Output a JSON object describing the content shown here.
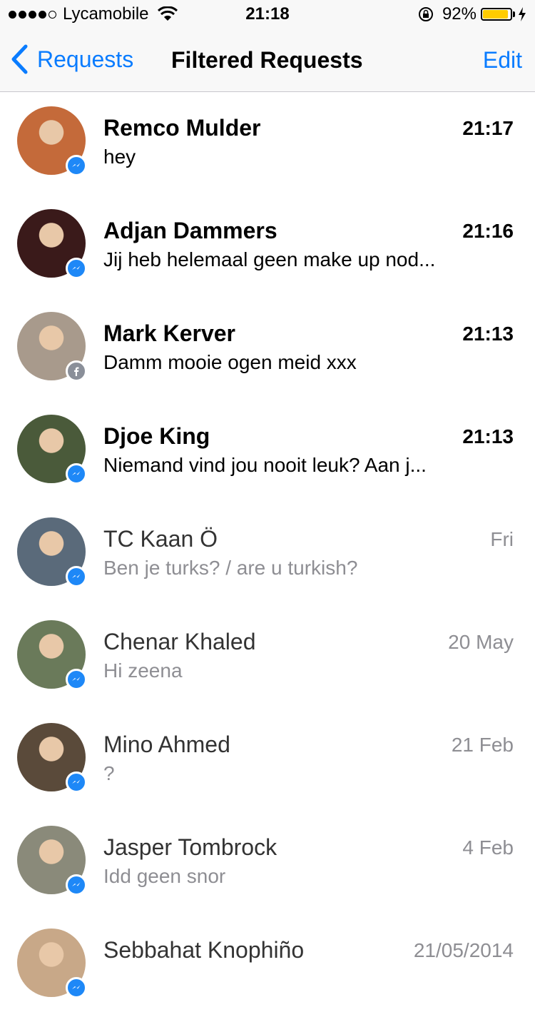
{
  "status_bar": {
    "carrier": "Lycamobile",
    "time": "21:18",
    "battery_percent": "92%",
    "battery_level": 0.92,
    "signal_bars": 4,
    "signal_max": 5,
    "battery_color": "#ffcc00"
  },
  "nav": {
    "back_label": "Requests",
    "title": "Filtered Requests",
    "edit_label": "Edit",
    "accent_color": "#0a7cff"
  },
  "conversations": [
    {
      "name": "Remco Mulder",
      "preview": "hey",
      "time": "21:17",
      "unread": true,
      "badge": "messenger-icon"
    },
    {
      "name": "Adjan Dammers",
      "preview": "Jij heb helemaal geen make up nod...",
      "time": "21:16",
      "unread": true,
      "badge": "messenger-icon"
    },
    {
      "name": "Mark Kerver",
      "preview": "Damm mooie ogen meid xxx",
      "time": "21:13",
      "unread": true,
      "badge": "facebook-icon"
    },
    {
      "name": "Djoe King",
      "preview": "Niemand vind jou nooit leuk? Aan j...",
      "time": "21:13",
      "unread": true,
      "badge": "messenger-icon"
    },
    {
      "name": "TC Kaan Ö",
      "preview": "Ben je turks? / are u turkish?",
      "time": "Fri",
      "unread": false,
      "badge": "messenger-icon"
    },
    {
      "name": "Chenar Khaled",
      "preview": "Hi zeena",
      "time": "20 May",
      "unread": false,
      "badge": "messenger-icon"
    },
    {
      "name": "Mino Ahmed",
      "preview": "?",
      "time": "21 Feb",
      "unread": false,
      "badge": "messenger-icon"
    },
    {
      "name": "Jasper Tombrock",
      "preview": "Idd geen snor",
      "time": "4 Feb",
      "unread": false,
      "badge": "messenger-icon"
    },
    {
      "name": "Sebbahat Knophiño",
      "preview": "",
      "time": "21/05/2014",
      "unread": false,
      "badge": "messenger-icon"
    }
  ],
  "avatar_colors": [
    "#c46a3a",
    "#3a1a1a",
    "#a89a8c",
    "#4a5a3a",
    "#5a6a7a",
    "#6a7a5a",
    "#5a4a3a",
    "#8a8a7a",
    "#c8a888"
  ]
}
